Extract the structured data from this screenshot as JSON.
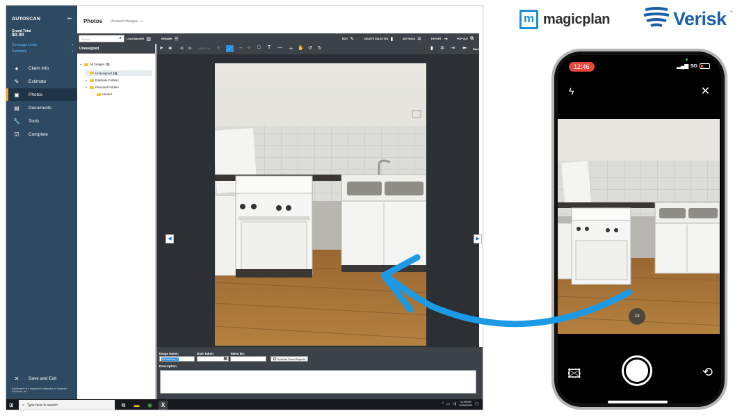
{
  "app": {
    "name": "AUTOSCAN",
    "grand_total_label": "Grand Total",
    "grand_total_value": "$0.00",
    "links": [
      "Coverage Limits",
      "Summary"
    ],
    "nav": [
      {
        "label": "Claim Info",
        "icon": "info-icon"
      },
      {
        "label": "Estimate",
        "icon": "estimate-icon"
      },
      {
        "label": "Photos",
        "icon": "photos-icon",
        "active": true
      },
      {
        "label": "Documents",
        "icon": "documents-icon"
      },
      {
        "label": "Tools",
        "icon": "wrench-icon"
      },
      {
        "label": "Complete",
        "icon": "checkbox-icon"
      }
    ],
    "exit_label": "Save and Exit",
    "trademark": "Xactimate® is a registered trademark of Xactware Solutions, Inc.",
    "accent": "#f5a623",
    "sidebar_color": "#2e4a62"
  },
  "page": {
    "title": "Photos",
    "status": "Unsaved changes"
  },
  "toolbar": {
    "search_placeholder": "Search",
    "load_images": "LOAD IMAGES",
    "rename": "RENAME",
    "edit": "EDIT",
    "delete_selected": "DELETE SELECTED",
    "settings": "SETTINGS",
    "export": "EXPORT",
    "pop_out": "POP OUT"
  },
  "folders": {
    "header": "Unassigned",
    "items": [
      {
        "label": "All Images",
        "count": "(3)"
      },
      {
        "label": "Unassigned",
        "count": "(3)"
      },
      {
        "label": "Estimate Folders"
      },
      {
        "label": "Personal Folders"
      },
      {
        "label": "Vendor"
      }
    ]
  },
  "viewer": {
    "undo_all": "UNDO ALL",
    "back": "Back"
  },
  "info": {
    "image_name_label": "Image Name:",
    "image_name_value": "01 Kitchen_1",
    "date_taken_label": "Date Taken:",
    "taken_by_label": "Taken By:",
    "exclude_label": "Exclude From Reports",
    "description_label": "Description:"
  },
  "taskbar": {
    "search_placeholder": "Type here to search",
    "time": "11:38 AM",
    "date": "10/26/2022"
  },
  "brands": {
    "magicplan": "magicplan",
    "magicplan_box": "m",
    "verisk": "Verisk",
    "verisk_tm": "™",
    "magicplan_color": "#1a8fd6",
    "verisk_color": "#1d5ea8"
  },
  "phone": {
    "time": "12:46",
    "network": "5G",
    "zoom": "1x"
  }
}
